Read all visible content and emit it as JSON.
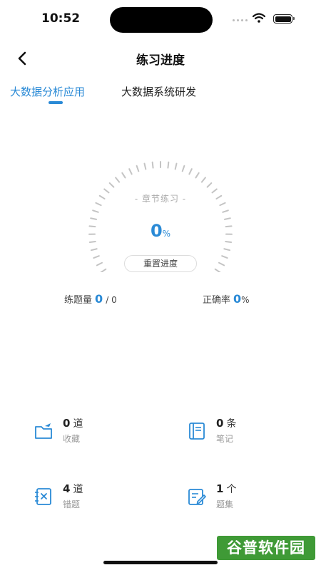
{
  "status_bar": {
    "time": "10:52"
  },
  "nav": {
    "title": "练习进度"
  },
  "tabs": [
    {
      "label": "大数据分析应用",
      "active": true
    },
    {
      "label": "大数据系统研发",
      "active": false
    }
  ],
  "progress": {
    "caption": "- 章节练习 -",
    "percent_value": "0",
    "percent_unit": "%",
    "reset_label": "重置进度"
  },
  "stats": {
    "practice_label": "练题量",
    "practice_done": "0",
    "practice_total": "/ 0",
    "accuracy_label": "正确率",
    "accuracy_value": "0",
    "accuracy_unit": "%"
  },
  "cards": [
    {
      "count": "0",
      "unit": "道",
      "label": "收藏",
      "icon": "favorites-folder-icon"
    },
    {
      "count": "0",
      "unit": "条",
      "label": "笔记",
      "icon": "notebook-icon"
    },
    {
      "count": "4",
      "unit": "道",
      "label": "错题",
      "icon": "wrong-questions-icon"
    },
    {
      "count": "1",
      "unit": "个",
      "label": "题集",
      "icon": "question-set-edit-icon"
    }
  ],
  "watermark": {
    "text": "谷普软件园"
  },
  "colors": {
    "accent": "#2a8ad6",
    "watermark_bg": "#3f9a36"
  }
}
